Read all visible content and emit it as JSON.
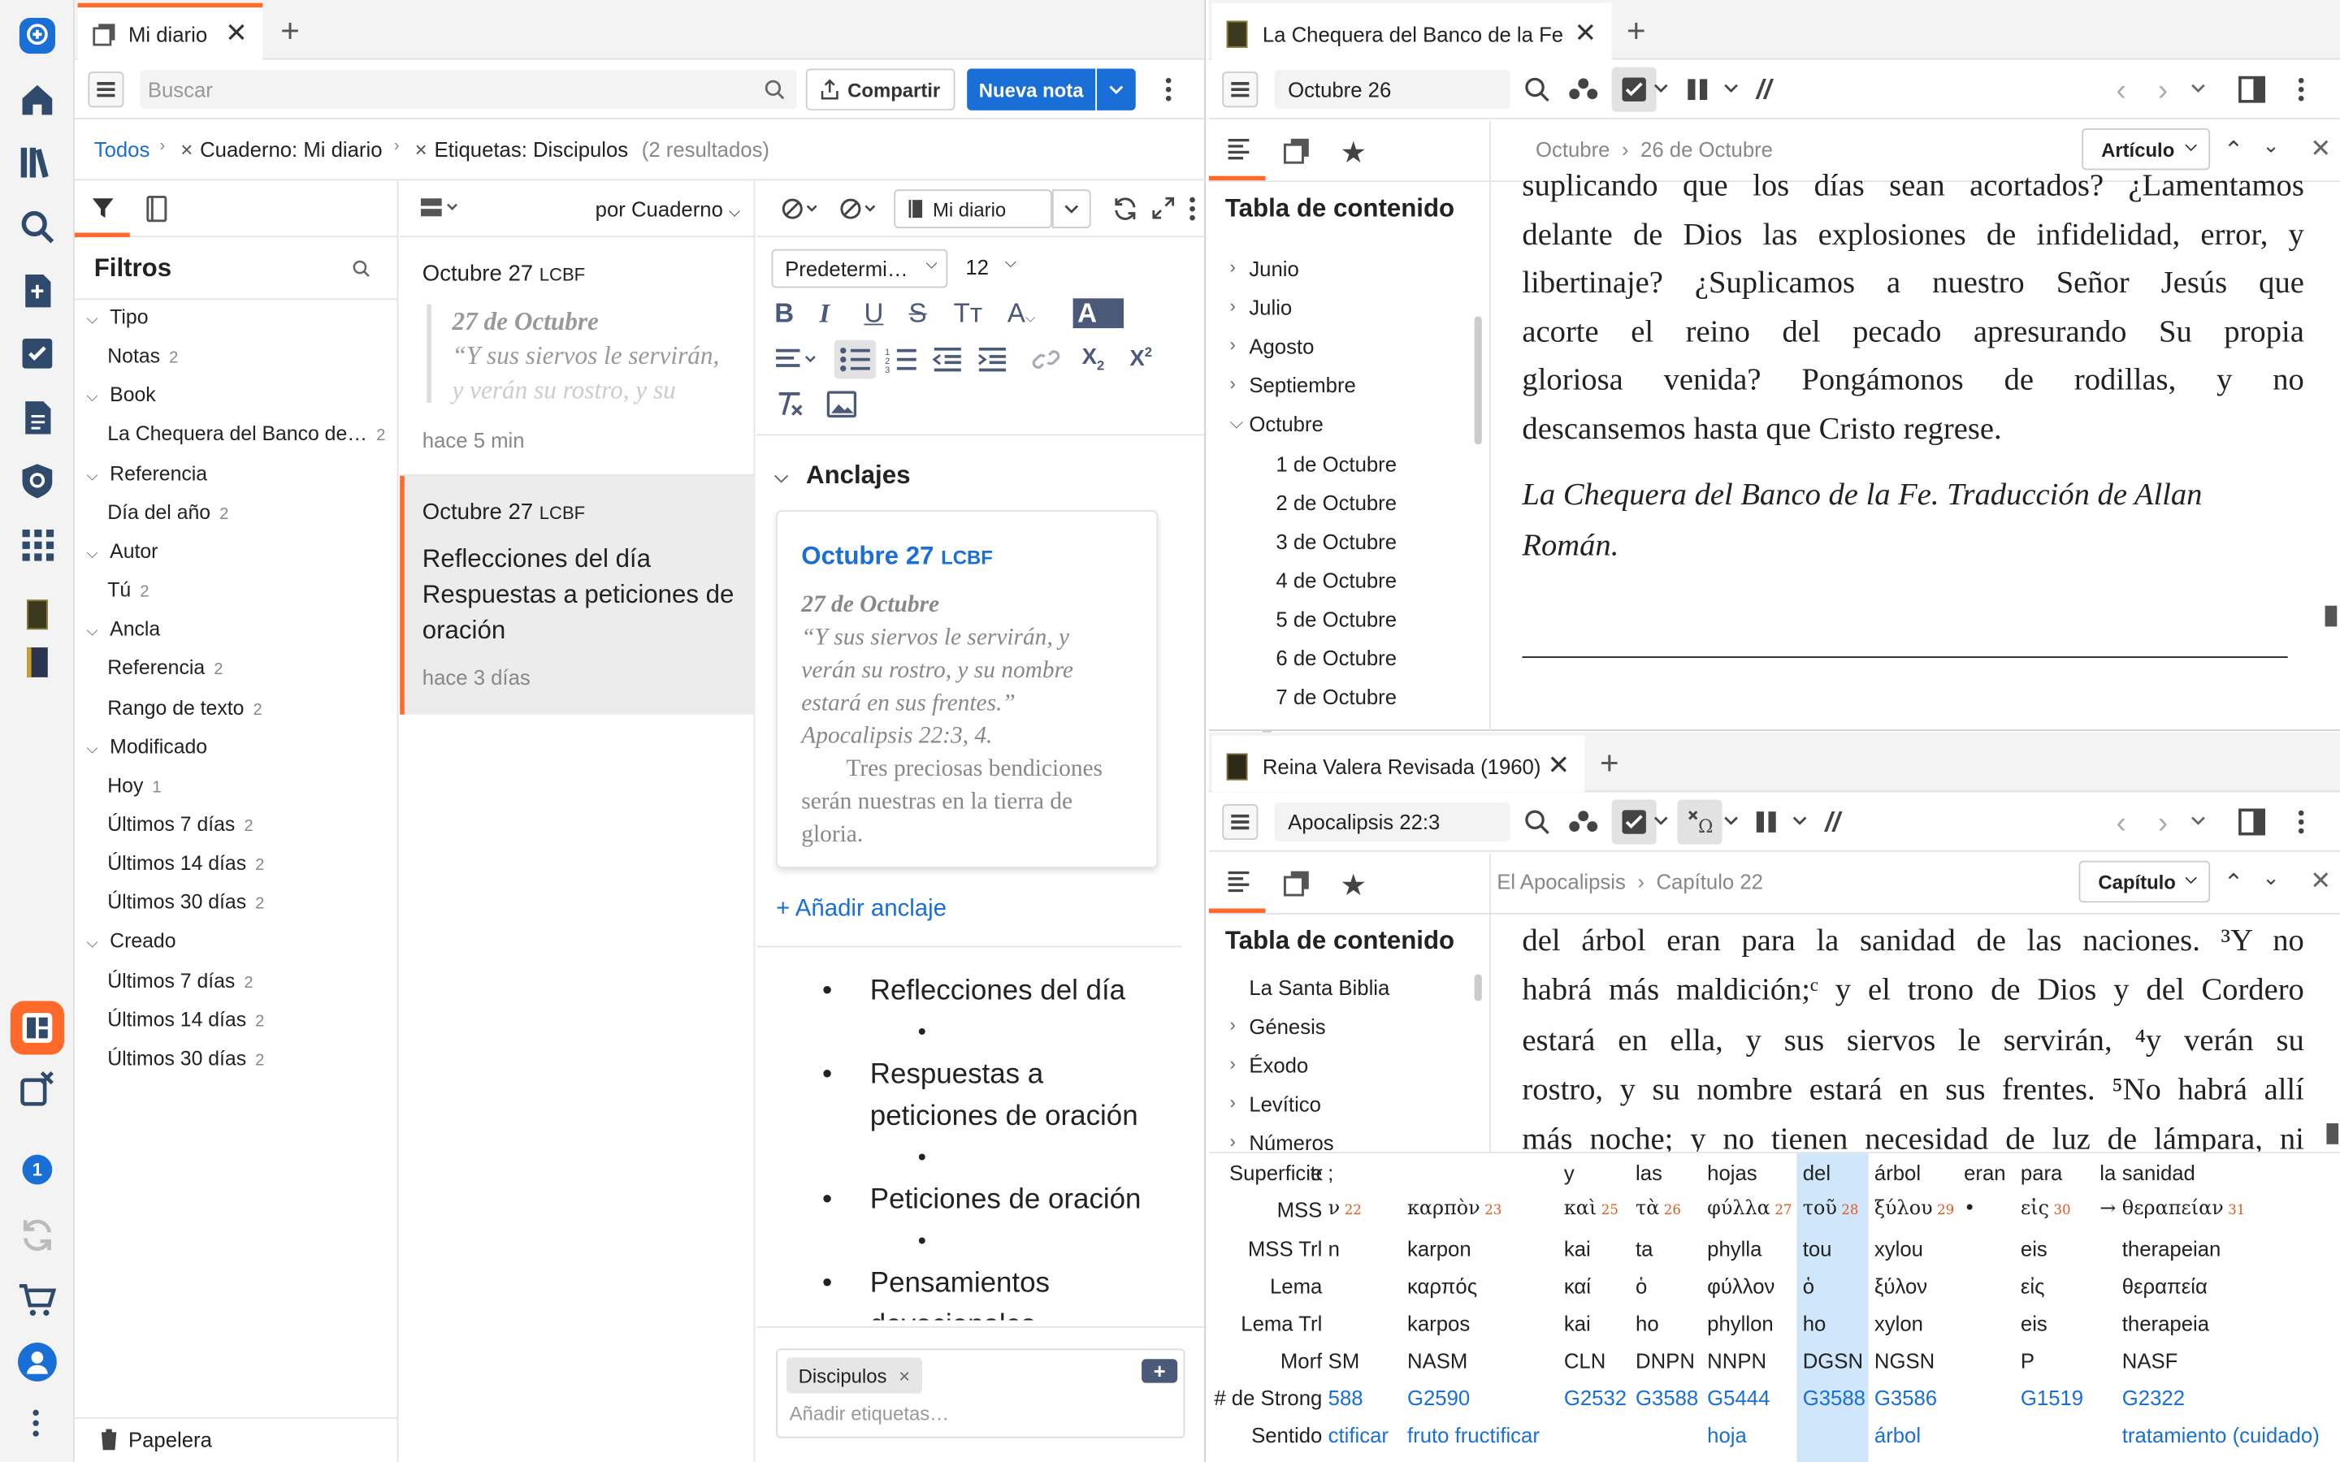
{
  "rail": {
    "icons": [
      "logos-icon",
      "home-icon",
      "library-icon",
      "search-icon",
      "add-document-icon",
      "checklist-icon",
      "document-icon",
      "factbook-icon",
      "apps-icon",
      "book-cover-icon",
      "book-cover-icon",
      "layout-icon",
      "close-panels-icon",
      "notification-badge",
      "sync-icon",
      "cart-icon",
      "account-icon",
      "more-icon"
    ],
    "badge": "1"
  },
  "left": {
    "tab_title": "Mi diario",
    "search_placeholder": "Buscar",
    "share_label": "Compartir",
    "new_note_label": "Nueva nota",
    "breadcrumb": {
      "all": "Todos",
      "notebook": "Cuaderno: Mi diario",
      "tags": "Etiquetas: Discipulos",
      "results": "(2 resultados)"
    },
    "filters_title": "Filtros",
    "filters": [
      {
        "type": "group",
        "label": "Tipo"
      },
      {
        "type": "item",
        "label": "Notas",
        "count": "2"
      },
      {
        "type": "group",
        "label": "Book"
      },
      {
        "type": "item",
        "label": "La Chequera del Banco de…",
        "count": "2"
      },
      {
        "type": "group",
        "label": "Referencia"
      },
      {
        "type": "item",
        "label": "Día del año",
        "count": "2"
      },
      {
        "type": "group",
        "label": "Autor"
      },
      {
        "type": "item",
        "label": "Tú",
        "count": "2"
      },
      {
        "type": "group",
        "label": "Ancla"
      },
      {
        "type": "item",
        "label": "Referencia",
        "count": "2"
      },
      {
        "type": "item",
        "label": "Rango de texto",
        "count": "2"
      },
      {
        "type": "group",
        "label": "Modificado"
      },
      {
        "type": "item",
        "label": "Hoy",
        "count": "1"
      },
      {
        "type": "item",
        "label": "Últimos 7 días",
        "count": "2"
      },
      {
        "type": "item",
        "label": "Últimos 14 días",
        "count": "2"
      },
      {
        "type": "item",
        "label": "Últimos 30 días",
        "count": "2"
      },
      {
        "type": "group",
        "label": "Creado"
      },
      {
        "type": "item",
        "label": "Últimos 7 días",
        "count": "2"
      },
      {
        "type": "item",
        "label": "Últimos 14 días",
        "count": "2"
      },
      {
        "type": "item",
        "label": "Últimos 30 días",
        "count": "2"
      }
    ],
    "trash": "Papelera",
    "sort_label": "por Cuaderno",
    "notes": [
      {
        "title": "Octubre 27",
        "title_abbr": "LCBF",
        "quote_head": "27 de Octubre",
        "quote_1": "“Y sus siervos le servirán,",
        "quote_2": "y verán su rostro, y su",
        "time": "hace 5 min"
      },
      {
        "title": "Octubre 27",
        "title_abbr": "LCBF",
        "body_1": "Reflecciones del día",
        "body_2": "Respuestas a peticiones de",
        "body_3": "oración",
        "time": "hace 3 días"
      }
    ],
    "editor": {
      "notebook": "Mi diario",
      "font": "Predetermi…",
      "size": "12",
      "anchors_title": "Anclajes",
      "anchor_title": "Octubre 27",
      "anchor_abbr": "LCBF",
      "anchor_head": "27 de Octubre",
      "anchor_q1": "“Y sus siervos le servirán, y",
      "anchor_q2": "verán su rostro, y su nombre",
      "anchor_q3": "estará en sus frentes.”",
      "anchor_ref": "Apocalipsis 22:3, 4.",
      "anchor_p1": "Tres preciosas bendiciones",
      "anchor_p2": "serán nuestras en la tierra de",
      "anchor_p3": "gloria.",
      "add_anchor": "+ Añadir anclaje",
      "bullets": [
        "Reflecciones del día",
        "Respuestas a",
        "peticiones de oración",
        "Peticiones de oración",
        "Pensamientos",
        "devocionales"
      ],
      "tag": "Discipulos",
      "tag_placeholder": "Añadir etiquetas…"
    }
  },
  "top_right": {
    "tab_title": "La Chequera del Banco de la Fe",
    "ref": "Octubre 26",
    "breadcrumb_1": "Octubre",
    "breadcrumb_2": "26 de Octubre",
    "scope": "Artículo",
    "toc_title": "Tabla de contenido",
    "toc": [
      {
        "label": "Junio",
        "level": 0
      },
      {
        "label": "Julio",
        "level": 0
      },
      {
        "label": "Agosto",
        "level": 0
      },
      {
        "label": "Septiembre",
        "level": 0
      },
      {
        "label": "Octubre",
        "level": 0,
        "open": true
      },
      {
        "label": "1 de Octubre",
        "level": 1
      },
      {
        "label": "2 de Octubre",
        "level": 1
      },
      {
        "label": "3 de Octubre",
        "level": 1
      },
      {
        "label": "4 de Octubre",
        "level": 1
      },
      {
        "label": "5 de Octubre",
        "level": 1
      },
      {
        "label": "6 de Octubre",
        "level": 1
      },
      {
        "label": "7 de Octubre",
        "level": 1
      }
    ],
    "text_lines": [
      "suplicando que los días sean acortados? ¿Lamentamos",
      "delante de Dios las explosiones de infidelidad, error, y",
      "libertinaje? ¿Suplicamos a nuestro Señor Jesús que",
      "acorte el reino del pecado apresurando Su propia",
      "gloriosa venida? Pongámonos de rodillas, y no",
      "descansemos hasta que Cristo regrese."
    ],
    "italic_1": "La Chequera del Banco de la Fe. Traducción de Allan",
    "italic_2": "Román."
  },
  "bottom_right": {
    "tab_title": "Reina Valera Revisada (1960)",
    "ref": "Apocalipsis 22:3",
    "breadcrumb_1": "El Apocalipsis",
    "breadcrumb_2": "Capítulo 22",
    "scope": "Capítulo",
    "toc_title": "Tabla de contenido",
    "toc": [
      {
        "label": "La Santa Biblia",
        "level": 0,
        "noarrow": true
      },
      {
        "label": "Génesis",
        "level": 0
      },
      {
        "label": "Éxodo",
        "level": 0
      },
      {
        "label": "Levítico",
        "level": 0
      },
      {
        "label": "Números",
        "level": 0
      }
    ],
    "verse_lines": [
      "del árbol eran para la sanidad de las naciones. ³Y no",
      "habrá más maldición;ᶜ y el trono de Dios y del Cordero",
      "estará en ella, y sus siervos le servirán, ⁴y verán su",
      "rostro, y su nombre estará en sus frentes. ⁵No habrá allí",
      "más noche; y no tienen necesidad de luz de lámpara, ni"
    ],
    "interlinear": {
      "row_labels": [
        "Superficie",
        "MSS",
        "MSS Trl",
        "Lema",
        "Lema Trl",
        "Morf",
        "# de Strong",
        "Sentido"
      ],
      "columns": [
        {
          "sup": "to;",
          "mss": "ν",
          "mssn": "22",
          "trl": "n",
          "lema": "",
          "ltrl": "",
          "morf": "SM",
          "strong": "588",
          "sent": "ctificar"
        },
        {
          "sup": "",
          "mss": "καρπὸν",
          "mssn": "23",
          "trl": "karpon",
          "lema": "καρπός",
          "ltrl": "karpos",
          "morf": "NASM",
          "strong": "G2590",
          "sent": "fruto fructificar"
        },
        {
          "sup": "y",
          "mss": "καὶ",
          "mssn": "25",
          "trl": "kai",
          "lema": "καί",
          "ltrl": "kai",
          "morf": "CLN",
          "strong": "G2532",
          "sent": ""
        },
        {
          "sup": "las",
          "mss": "τὰ",
          "mssn": "26",
          "trl": "ta",
          "lema": "ὁ",
          "ltrl": "ho",
          "morf": "DNPN",
          "strong": "G3588",
          "sent": ""
        },
        {
          "sup": "hojas",
          "mss": "φύλλα",
          "mssn": "27",
          "trl": "phylla",
          "lema": "φύλλον",
          "ltrl": "phyllon",
          "morf": "NNPN",
          "strong": "G5444",
          "sent": "hoja"
        },
        {
          "sup": "del",
          "mss": "τοῦ",
          "mssn": "28",
          "trl": "tou",
          "lema": "ὁ",
          "ltrl": "ho",
          "morf": "DGSN",
          "strong": "G3588",
          "sent": ""
        },
        {
          "sup": "árbol",
          "mss": "ξύλου",
          "mssn": "29",
          "trl": "xylou",
          "lema": "ξύλον",
          "ltrl": "xylon",
          "morf": "NGSN",
          "strong": "G3586",
          "sent": "árbol"
        },
        {
          "sup": "eran",
          "mss": "•",
          "mssn": "",
          "trl": "",
          "lema": "",
          "ltrl": "",
          "morf": "",
          "strong": "",
          "sent": ""
        },
        {
          "sup": "para",
          "mss": "εἰς",
          "mssn": "30",
          "trl": "eis",
          "lema": "εἰς",
          "ltrl": "eis",
          "morf": "P",
          "strong": "G1519",
          "sent": ""
        },
        {
          "sup": "la",
          "mss": "→",
          "mssn": "",
          "trl": "",
          "lema": "",
          "ltrl": "",
          "morf": "",
          "strong": "",
          "sent": ""
        },
        {
          "sup": "sanidad",
          "mss": "θεραπείαν",
          "mssn": "31",
          "trl": "therapeian",
          "lema": "θεραπεία",
          "ltrl": "therapeia",
          "morf": "NASF",
          "strong": "G2322",
          "sent": "tratamiento (cuidado)"
        }
      ]
    }
  },
  "colors": {
    "accent": "#ff6a2a",
    "blue": "#1a6fd6",
    "highlight": "#cfe6fb"
  }
}
